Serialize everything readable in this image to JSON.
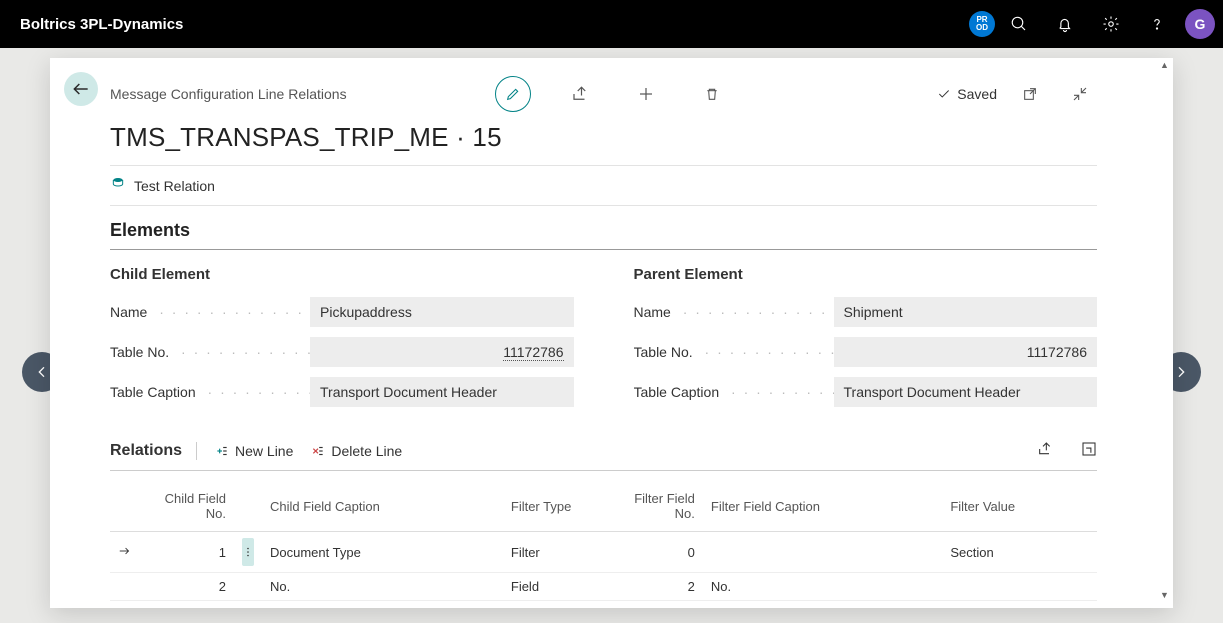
{
  "topbar": {
    "app_name": "Boltrics 3PL-Dynamics",
    "env_line1": "PR",
    "env_line2": "OD",
    "avatar_initial": "G"
  },
  "header": {
    "breadcrumb": "Message Configuration Line Relations",
    "title": "TMS_TRANSPAS_TRIP_ME · 15",
    "saved_label": "Saved"
  },
  "actions": {
    "test_relation_label": "Test Relation"
  },
  "elements": {
    "section_title": "Elements",
    "child": {
      "heading": "Child Element",
      "name_label": "Name",
      "name_value": "Pickupaddress",
      "table_no_label": "Table No.",
      "table_no_value": "11172786",
      "table_caption_label": "Table Caption",
      "table_caption_value": "Transport Document Header"
    },
    "parent": {
      "heading": "Parent Element",
      "name_label": "Name",
      "name_value": "Shipment",
      "table_no_label": "Table No.",
      "table_no_value": "11172786",
      "table_caption_label": "Table Caption",
      "table_caption_value": "Transport Document Header"
    }
  },
  "relations": {
    "title": "Relations",
    "new_line_label": "New Line",
    "delete_line_label": "Delete Line",
    "columns": {
      "child_field_no": "Child Field No.",
      "child_field_caption": "Child Field Caption",
      "filter_type": "Filter Type",
      "filter_field_no": "Filter Field No.",
      "filter_field_caption": "Filter Field Caption",
      "filter_value": "Filter Value"
    },
    "rows": [
      {
        "child_field_no": "1",
        "child_field_caption": "Document Type",
        "filter_type": "Filter",
        "filter_field_no": "0",
        "filter_field_caption": "",
        "filter_value": "Section",
        "selected": true
      },
      {
        "child_field_no": "2",
        "child_field_caption": "No.",
        "filter_type": "Field",
        "filter_field_no": "2",
        "filter_field_caption": "No.",
        "filter_value": "",
        "selected": false
      }
    ]
  }
}
